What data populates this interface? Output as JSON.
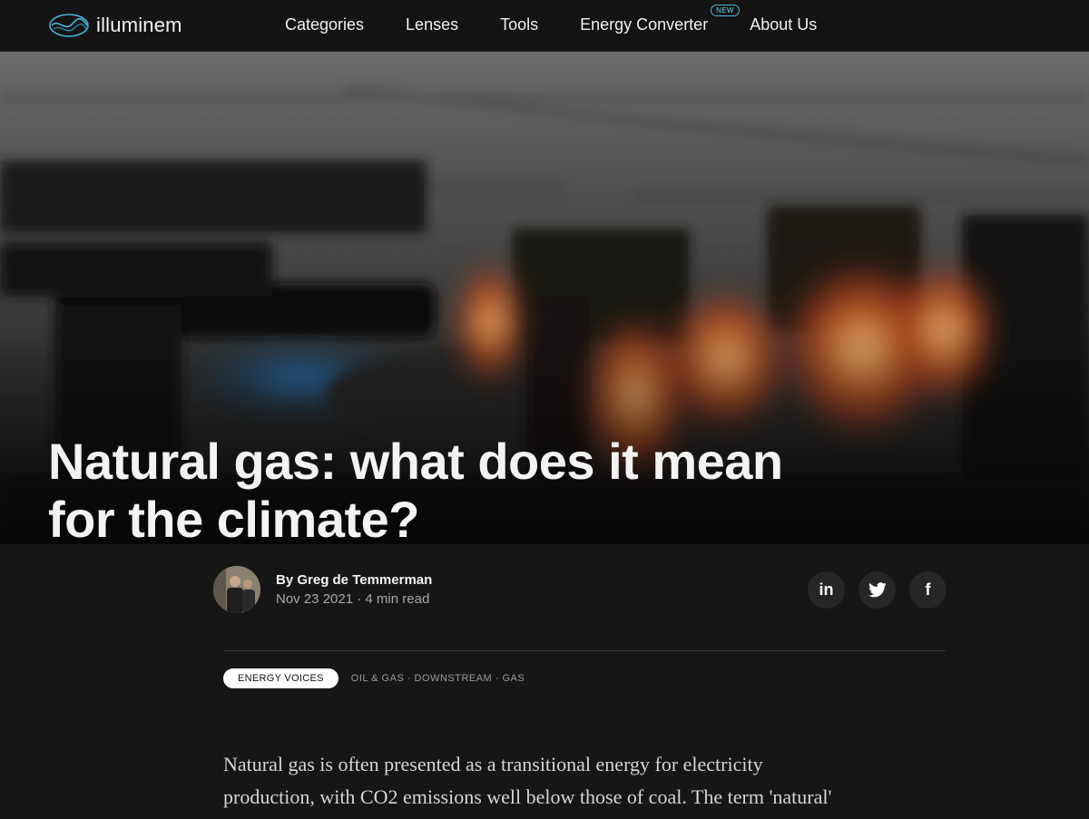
{
  "site": {
    "logo_text": "illuminem"
  },
  "nav": {
    "items": [
      {
        "label": "Categories"
      },
      {
        "label": "Lenses"
      },
      {
        "label": "Tools"
      },
      {
        "label": "Energy Converter",
        "badge": "NEW"
      },
      {
        "label": "About Us"
      }
    ]
  },
  "article": {
    "title_line1": "Natural gas: what does it mean",
    "title_line2": "for the climate?",
    "author": "By Greg de Temmerman",
    "date": "Nov 23 2021",
    "read_time": "4 min read",
    "primary_tag": "ENERGY VOICES",
    "tags": "OIL & GAS · DOWNSTREAM · GAS",
    "body_line1": "Natural gas is often presented as a transitional energy for electricity",
    "body_line2": "production, with CO2 emissions well below those of coal. The term 'natural'"
  },
  "share": {
    "linkedin_label": "in",
    "twitter_icon": "twitter-icon",
    "facebook_label": "f"
  },
  "colors": {
    "background": "#161616",
    "nav_bg": "#141414",
    "accent": "#4fb6d4",
    "flame_orange": "#e8622a",
    "flame_blue": "#2f7fc4"
  }
}
